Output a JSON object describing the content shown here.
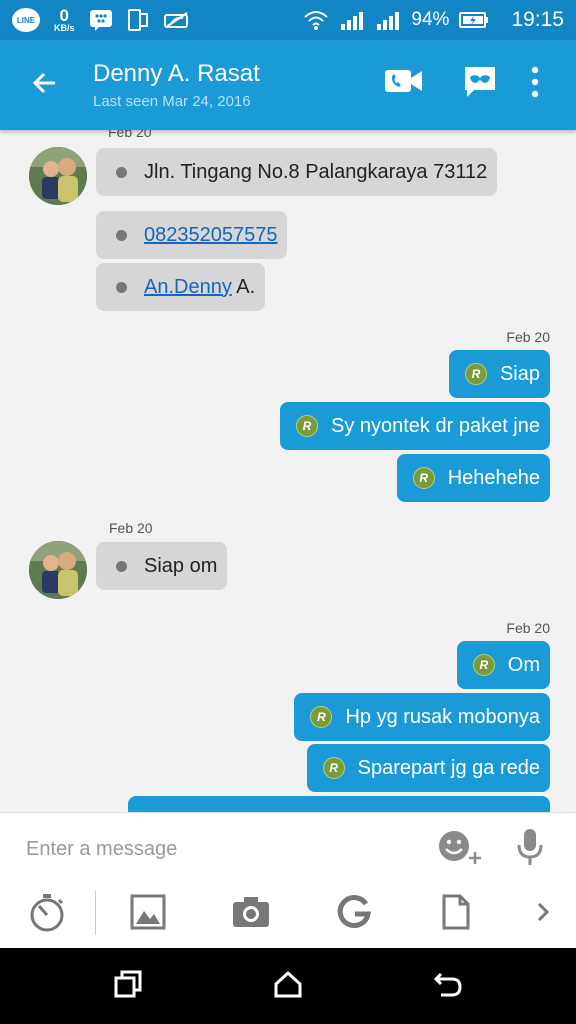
{
  "status_bar": {
    "line_label": "LINE",
    "net_speed": "0",
    "net_unit": "KB/s",
    "battery": "94%",
    "time": "19:15"
  },
  "header": {
    "contact_name": "Denny A. Rasat",
    "last_seen": "Last seen Mar 24, 2016"
  },
  "chat": {
    "top_date_partial": "Feb 20",
    "incoming_group_1": [
      {
        "text": "Jln. Tingang No.8 Palangkaraya 73112"
      },
      {
        "link": "082352057575",
        "text": ""
      },
      {
        "link": "An.Denny",
        "text": " A."
      }
    ],
    "outgoing_group_1": {
      "date": "Feb 20",
      "messages": [
        "Siap",
        "Sy nyontek dr paket jne",
        "Hehehehe"
      ]
    },
    "incoming_group_2": {
      "date": "Feb 20",
      "messages": [
        "Siap om"
      ]
    },
    "outgoing_group_2": {
      "date": "Feb 20",
      "messages": [
        "Om",
        "Hp yg rusak mobonya",
        "Sparepart jg ga rede"
      ]
    },
    "read_badge": "R"
  },
  "composer": {
    "placeholder": "Enter a message"
  },
  "icons": {
    "back": "arrow-left-icon",
    "video_call": "video-call-icon",
    "chat_mask": "chat-mask-icon",
    "overflow": "more-vert-icon",
    "emoji": "emoji-add-icon",
    "mic": "microphone-icon",
    "timer": "stopwatch-icon",
    "gallery": "image-icon",
    "camera": "camera-icon",
    "google": "google-icon",
    "file": "file-icon",
    "more_tools": "chevron-right-icon"
  },
  "colors": {
    "primary": "#1a9ad6",
    "status_bar": "#1286c4",
    "incoming_bubble": "#d6d6d6",
    "outgoing_bubble": "#1a9ad6",
    "read_badge": "#7b9a3a"
  }
}
